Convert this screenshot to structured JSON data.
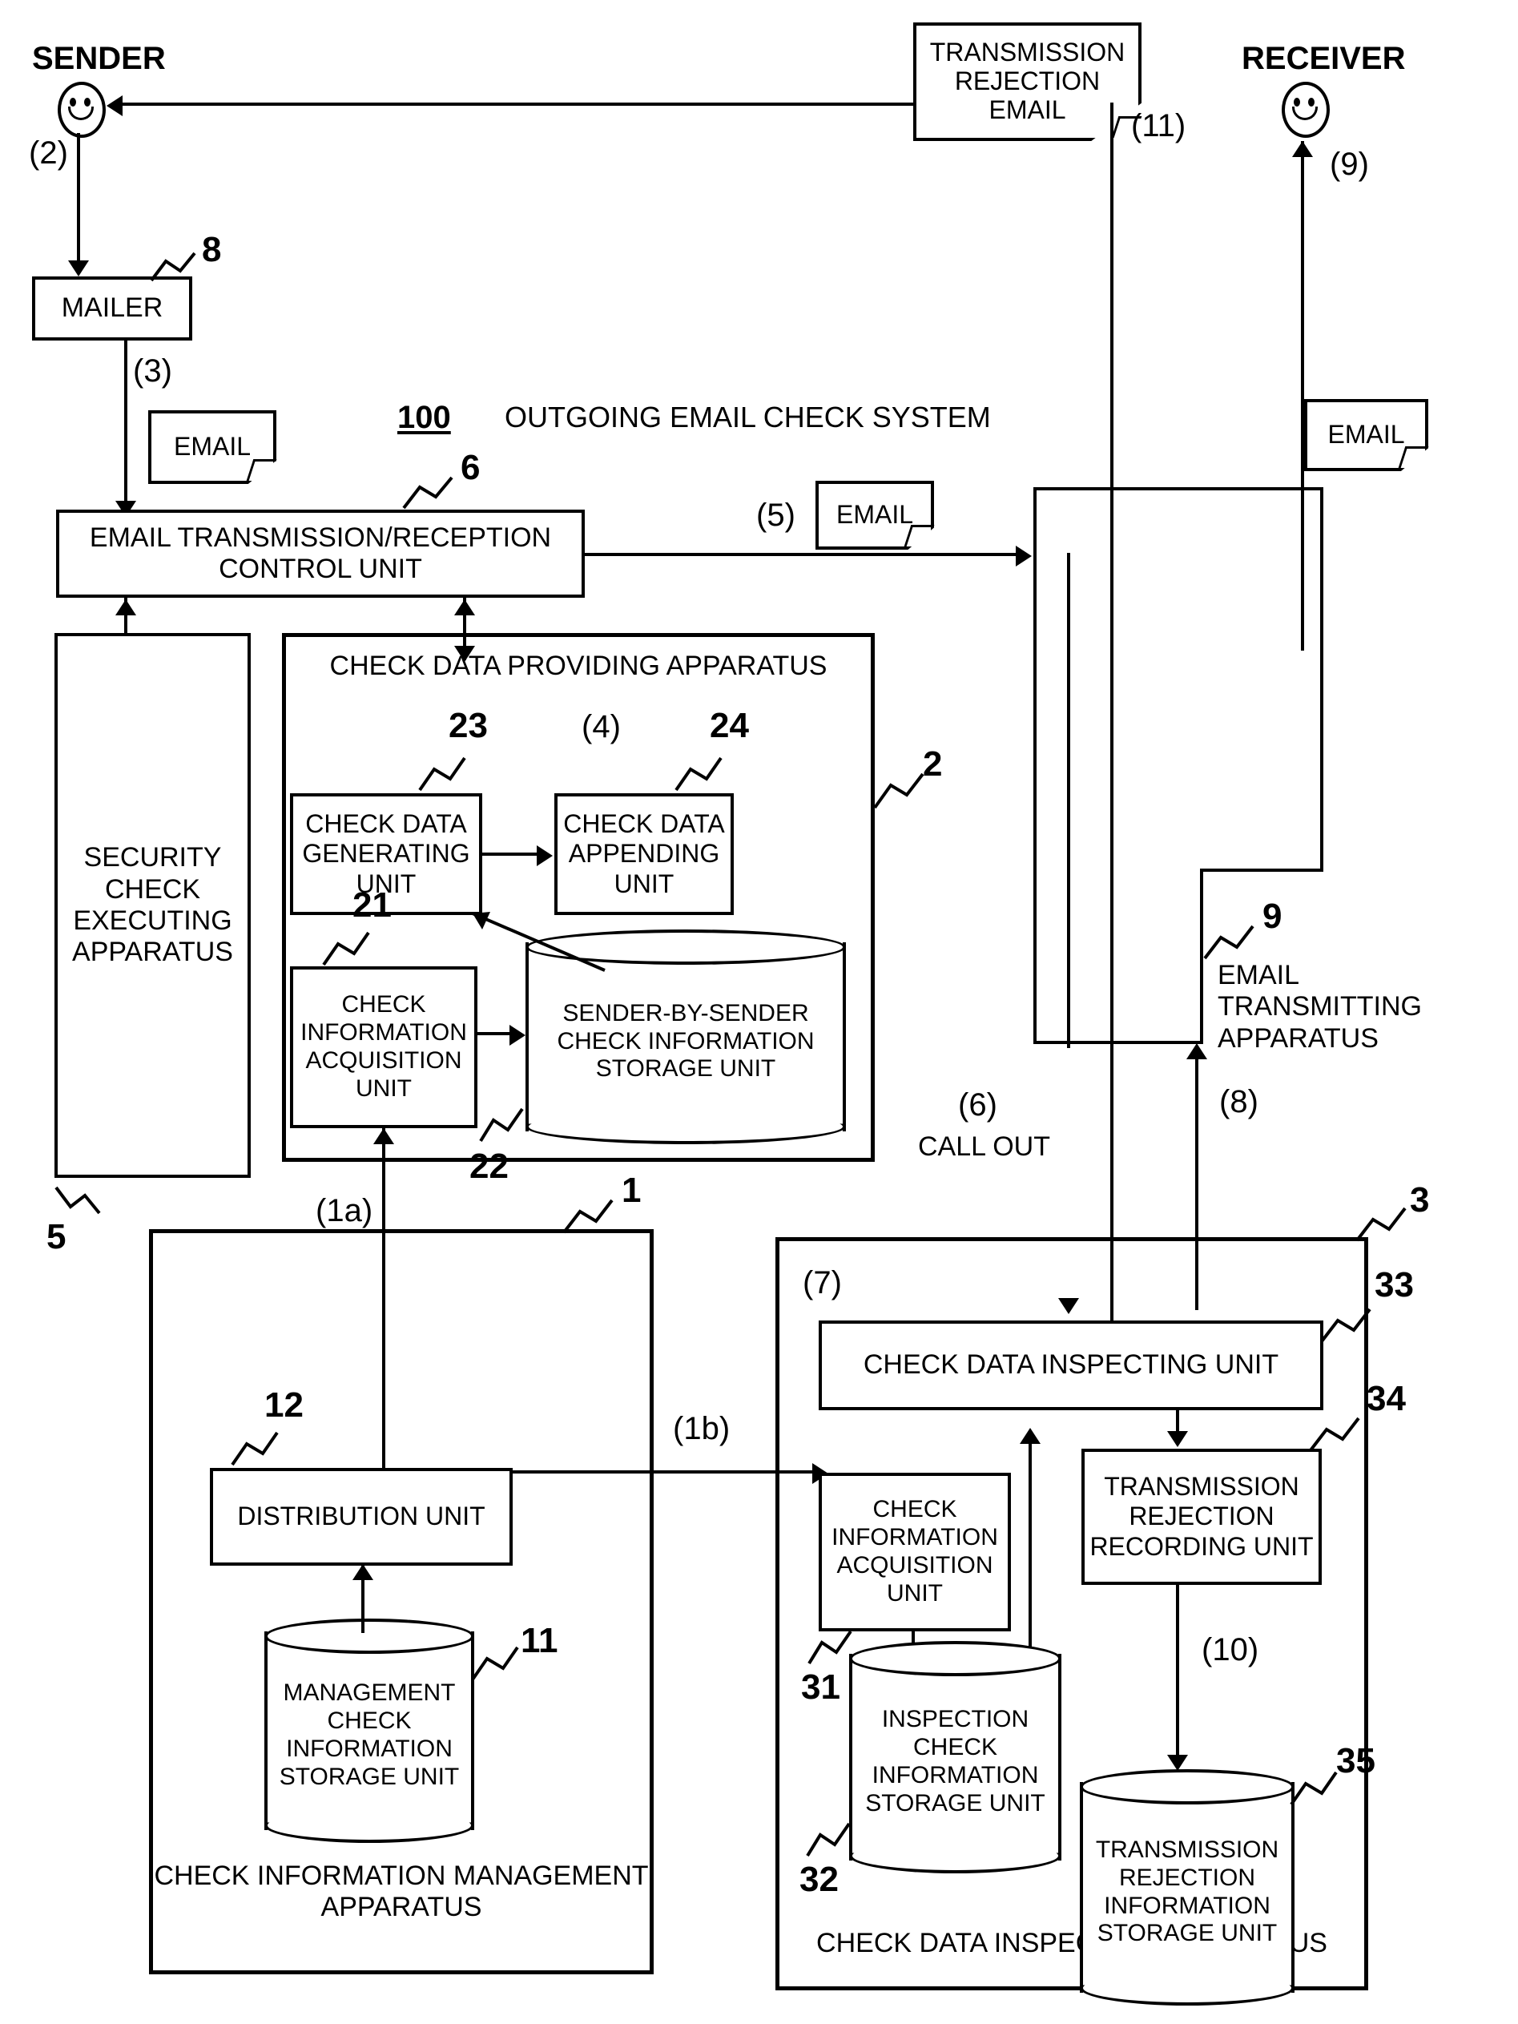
{
  "figure": {
    "system_number": "100",
    "system_title": "OUTGOING EMAIL CHECK SYSTEM"
  },
  "actors": {
    "sender_label": "SENDER",
    "receiver_label": "RECEIVER"
  },
  "notes": {
    "rejection_email": "TRANSMISSION\nREJECTION\nEMAIL",
    "email_3": "EMAIL",
    "email_5": "EMAIL",
    "email_9": "EMAIL"
  },
  "blocks": {
    "mailer": {
      "label": "MAILER",
      "ref": "8"
    },
    "control_unit": {
      "label": "EMAIL TRANSMISSION/RECEPTION\nCONTROL UNIT",
      "ref": "6"
    },
    "security_check": {
      "label": "SECURITY\nCHECK\nEXECUTING\nAPPARATUS",
      "ref": "5"
    },
    "providing_apparatus": {
      "label": "CHECK DATA PROVIDING APPARATUS",
      "ref": "2"
    },
    "check_data_generating": {
      "label": "CHECK DATA\nGENERATING\nUNIT",
      "ref": "23"
    },
    "check_data_appending": {
      "label": "CHECK DATA\nAPPENDING\nUNIT",
      "ref": "24"
    },
    "check_info_acq_21": {
      "label": "CHECK\nINFORMATION\nACQUISITION\nUNIT",
      "ref": "21"
    },
    "sender_by_sender_storage": {
      "label": "SENDER-BY-SENDER\nCHECK INFORMATION\nSTORAGE UNIT",
      "ref": "22"
    },
    "email_transmitting": {
      "label": "EMAIL\nTRANSMITTING\nAPPARATUS",
      "ref": "9"
    },
    "management_apparatus": {
      "label": "CHECK INFORMATION MANAGEMENT\nAPPARATUS",
      "ref": "1"
    },
    "distribution_unit": {
      "label": "DISTRIBUTION UNIT",
      "ref": "12"
    },
    "management_storage": {
      "label": "MANAGEMENT\nCHECK\nINFORMATION\nSTORAGE UNIT",
      "ref": "11"
    },
    "inspecting_apparatus": {
      "label": "CHECK DATA INSPECTING APPARATUS",
      "ref": "3"
    },
    "check_data_inspecting_unit": {
      "label": "CHECK DATA INSPECTING UNIT",
      "ref": "33"
    },
    "check_info_acq_31": {
      "label": "CHECK\nINFORMATION\nACQUISITION\nUNIT",
      "ref": "31"
    },
    "transmission_rejection_recording": {
      "label": "TRANSMISSION\nREJECTION\nRECORDING UNIT",
      "ref": "34"
    },
    "inspection_storage": {
      "label": "INSPECTION\nCHECK\nINFORMATION\nSTORAGE UNIT",
      "ref": "32"
    },
    "rejection_info_storage": {
      "label": "TRANSMISSION\nREJECTION\nINFORMATION\nSTORAGE UNIT",
      "ref": "35"
    }
  },
  "steps": {
    "s1a": "(1a)",
    "s1b": "(1b)",
    "s2": "(2)",
    "s3": "(3)",
    "s4": "(4)",
    "s5": "(5)",
    "s6": "(6)",
    "s6_note": "CALL OUT",
    "s7": "(7)",
    "s8": "(8)",
    "s9": "(9)",
    "s10": "(10)",
    "s11": "(11)"
  }
}
